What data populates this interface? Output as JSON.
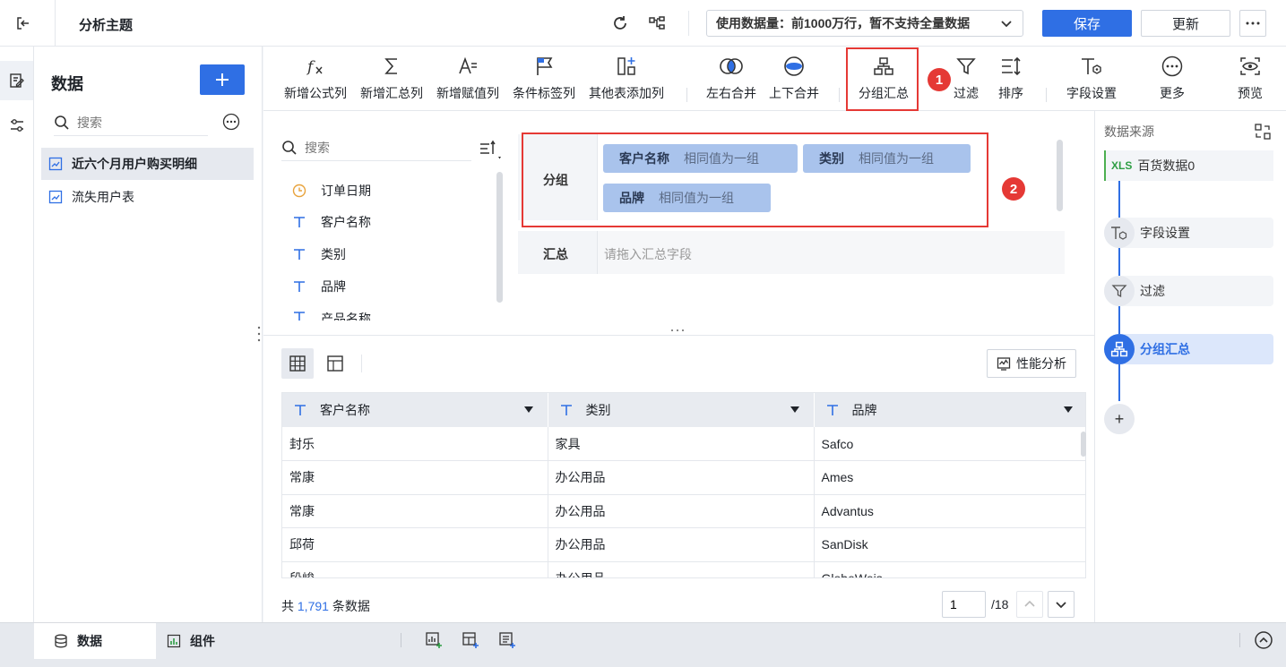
{
  "header": {
    "title": "分析主题",
    "usage_text": "使用数据量：前1000万行，暂不支持全量数据",
    "save_label": "保存",
    "update_label": "更新"
  },
  "side": {
    "title": "数据",
    "search_placeholder": "搜索",
    "tables": [
      "近六个月用户购买明细",
      "流失用户表"
    ]
  },
  "toolbar": {
    "items": [
      {
        "label": "新增公式列",
        "icon": "formula-icon"
      },
      {
        "label": "新增汇总列",
        "icon": "sigma-icon"
      },
      {
        "label": "新增赋值列",
        "icon": "assign-icon"
      },
      {
        "label": "条件标签列",
        "icon": "flag-icon"
      },
      {
        "label": "其他表添加列",
        "icon": "add-column-icon"
      },
      {
        "label": "左右合并",
        "icon": "merge-horizontal-icon"
      },
      {
        "label": "上下合并",
        "icon": "merge-vertical-icon"
      },
      {
        "label": "分组汇总",
        "icon": "group-summary-icon"
      },
      {
        "label": "过滤",
        "icon": "filter-icon"
      },
      {
        "label": "排序",
        "icon": "sort-icon"
      },
      {
        "label": "字段设置",
        "icon": "field-settings-icon"
      },
      {
        "label": "更多",
        "icon": "more-icon"
      },
      {
        "label": "预览",
        "icon": "preview-icon"
      }
    ],
    "badge1": "1",
    "badge2": "2"
  },
  "fields": {
    "search_placeholder": "搜索",
    "items": [
      {
        "label": "订单日期",
        "type": "date"
      },
      {
        "label": "客户名称",
        "type": "text"
      },
      {
        "label": "类别",
        "type": "text"
      },
      {
        "label": "品牌",
        "type": "text"
      },
      {
        "label": "产品名称",
        "type": "text"
      }
    ]
  },
  "config": {
    "group_label": "分组",
    "summary_label": "汇总",
    "summary_placeholder": "请拖入汇总字段",
    "group_chips": [
      {
        "name": "客户名称",
        "rule": "相同值为一组"
      },
      {
        "name": "类别",
        "rule": "相同值为一组"
      },
      {
        "name": "品牌",
        "rule": "相同值为一组"
      }
    ]
  },
  "preview": {
    "perf_label": "性能分析",
    "columns": [
      "客户名称",
      "类别",
      "品牌"
    ],
    "rows": [
      [
        "封乐",
        "家具",
        "Safco"
      ],
      [
        "常康",
        "办公用品",
        "Ames"
      ],
      [
        "常康",
        "办公用品",
        "Advantus"
      ],
      [
        "邱荷",
        "办公用品",
        "SanDisk"
      ],
      [
        "段峻",
        "办公用品",
        "GlobeWeis"
      ]
    ],
    "total_prefix": "共",
    "total_count": "1,791",
    "total_suffix": "条数据",
    "page_current": "1",
    "page_total": "/18"
  },
  "flow": {
    "source_title": "数据来源",
    "source_badge": "XLS",
    "source_name": "百货数据0",
    "steps": [
      {
        "label": "字段设置",
        "active": false
      },
      {
        "label": "过滤",
        "active": false
      },
      {
        "label": "分组汇总",
        "active": true
      }
    ],
    "add_label": "+"
  },
  "bottom": {
    "tab_data": "数据",
    "tab_comp": "组件"
  },
  "colors": {
    "accent": "#2f6fe4",
    "highlight": "#e53935",
    "chip": "#a9c3ec"
  }
}
